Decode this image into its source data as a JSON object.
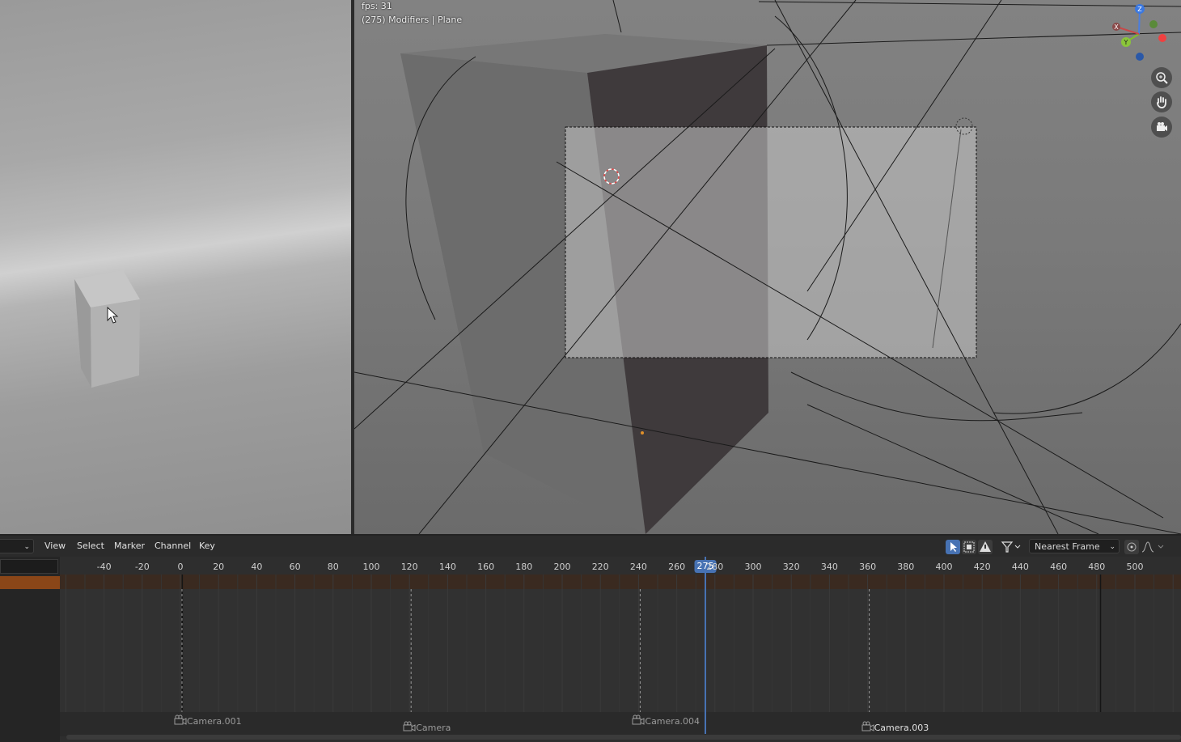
{
  "viewport": {
    "fps_text": "fps: 31",
    "info_text": "(275) Modifiers | Plane",
    "gizmo": {
      "x_label": "X",
      "y_label": "Y",
      "z_label": "Z"
    },
    "nav_icons": [
      "zoom-icon",
      "pan-hand-icon",
      "camera-icon"
    ]
  },
  "timeline": {
    "editor_menu": [
      "View",
      "Select",
      "Marker",
      "Channel",
      "Key"
    ],
    "snap_dropdown": "Nearest Frame",
    "current_frame": "275",
    "ruler_ticks": [
      "-40",
      "-20",
      "0",
      "20",
      "40",
      "60",
      "80",
      "100",
      "120",
      "140",
      "160",
      "180",
      "200",
      "220",
      "240",
      "260",
      "280",
      "300",
      "320",
      "340",
      "360",
      "380",
      "400",
      "420",
      "440",
      "460",
      "480",
      "500"
    ],
    "markers": [
      {
        "label": "Camera.001",
        "frame": 0
      },
      {
        "label": "Camera",
        "frame": 120
      },
      {
        "label": "Camera.004",
        "frame": 240
      },
      {
        "label": "Camera.003",
        "frame": 360
      }
    ],
    "colors": {
      "playhead": "#4772b3",
      "summary_row": "#7a3b12"
    }
  }
}
